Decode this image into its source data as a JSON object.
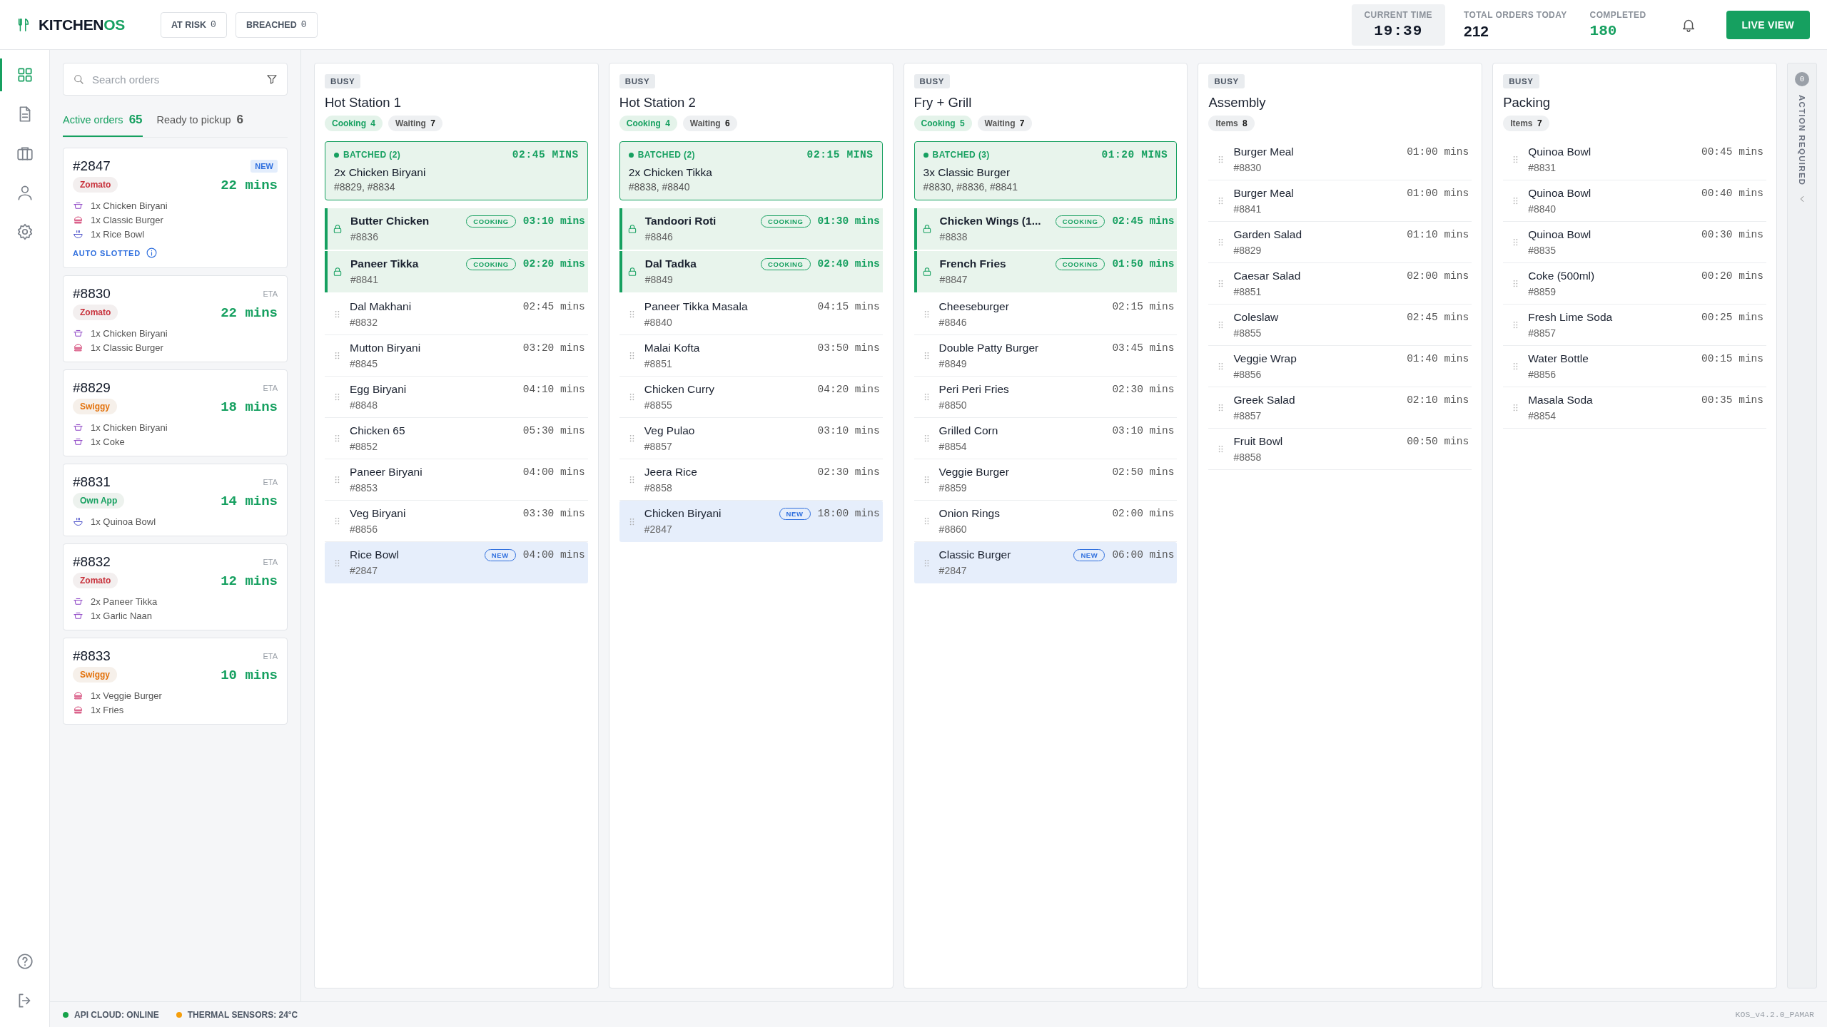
{
  "header": {
    "logo": {
      "primary": "KITCHEN",
      "accent": "OS"
    },
    "alerts": [
      {
        "label": "AT RISK",
        "count": "0"
      },
      {
        "label": "BREACHED",
        "count": "0"
      }
    ],
    "stats": [
      {
        "label": "CURRENT TIME",
        "value": "19:39",
        "kind": "boxed"
      },
      {
        "label": "TOTAL ORDERS TODAY",
        "value": "212",
        "kind": "plain"
      },
      {
        "label": "COMPLETED",
        "value": "180",
        "kind": "success"
      }
    ],
    "live_button": "LIVE VIEW"
  },
  "nav": {
    "items": [
      {
        "kind": "grid",
        "selected": true
      },
      {
        "kind": "document",
        "selected": false
      },
      {
        "kind": "briefcase",
        "selected": false
      },
      {
        "kind": "user",
        "selected": false
      },
      {
        "kind": "settings",
        "selected": false
      }
    ],
    "bottom": [
      {
        "kind": "help"
      },
      {
        "kind": "logout"
      }
    ]
  },
  "orders_panel": {
    "search": {
      "placeholder": "Search orders"
    },
    "tabs": [
      {
        "label": "Active orders",
        "count": "65",
        "selected": true
      },
      {
        "label": "Ready to pickup",
        "count": "6",
        "selected": false
      }
    ],
    "orders": [
      {
        "id": "#2847",
        "badge": {
          "text": "NEW",
          "kind": "new"
        },
        "source": {
          "name": "Zomato",
          "kind": "zomato"
        },
        "eta": "22 mins",
        "items": [
          {
            "text": "1x Chicken Biryani",
            "kind": "pot"
          },
          {
            "text": "1x Classic Burger",
            "kind": "burger"
          },
          {
            "text": "1x Rice Bowl",
            "kind": "bowl"
          }
        ],
        "auto_slot": "AUTO SLOTTED"
      },
      {
        "id": "#8830",
        "badge": {
          "text": "ETA",
          "kind": "eta"
        },
        "source": {
          "name": "Zomato",
          "kind": "zomato"
        },
        "eta": "22 mins",
        "items": [
          {
            "text": "1x Chicken Biryani",
            "kind": "pot"
          },
          {
            "text": "1x Classic Burger",
            "kind": "burger"
          }
        ]
      },
      {
        "id": "#8829",
        "badge": {
          "text": "ETA",
          "kind": "eta"
        },
        "source": {
          "name": "Swiggy",
          "kind": "swiggy"
        },
        "eta": "18 mins",
        "items": [
          {
            "text": "1x Chicken Biryani",
            "kind": "pot"
          },
          {
            "text": "1x Coke",
            "kind": "pot"
          }
        ]
      },
      {
        "id": "#8831",
        "badge": {
          "text": "ETA",
          "kind": "eta"
        },
        "source": {
          "name": "Own App",
          "kind": "own"
        },
        "eta": "14 mins",
        "items": [
          {
            "text": "1x Quinoa Bowl",
            "kind": "bowl"
          }
        ]
      },
      {
        "id": "#8832",
        "badge": {
          "text": "ETA",
          "kind": "eta"
        },
        "source": {
          "name": "Zomato",
          "kind": "zomato"
        },
        "eta": "12 mins",
        "items": [
          {
            "text": "2x Paneer Tikka",
            "kind": "pot"
          },
          {
            "text": "1x Garlic Naan",
            "kind": "pot"
          }
        ]
      },
      {
        "id": "#8833",
        "badge": {
          "text": "ETA",
          "kind": "eta"
        },
        "source": {
          "name": "Swiggy",
          "kind": "swiggy"
        },
        "eta": "10 mins",
        "items": [
          {
            "text": "1x Veggie Burger",
            "kind": "burger"
          },
          {
            "text": "1x Fries",
            "kind": "burger"
          }
        ]
      }
    ]
  },
  "stations": [
    {
      "status": "BUSY",
      "name": "Hot Station 1",
      "counts": [
        {
          "label": "Cooking",
          "value": "4",
          "kind": "cooking"
        },
        {
          "label": "Waiting",
          "value": "7",
          "kind": "waiting"
        }
      ],
      "batch": {
        "label": "BATCHED (2)",
        "time": "02:45 MINS",
        "title": "2x Chicken Biryani",
        "orders": "#8829, #8834"
      },
      "items": [
        {
          "name": "Butter Chicken",
          "order": "#8836",
          "time": "03:10 mins",
          "kind": "cooking",
          "tag": "COOKING"
        },
        {
          "name": "Paneer Tikka",
          "order": "#8841",
          "time": "02:20 mins",
          "kind": "cooking",
          "tag": "COOKING"
        },
        {
          "name": "Dal Makhani",
          "order": "#8832",
          "time": "02:45 mins",
          "kind": "queued"
        },
        {
          "name": "Mutton Biryani",
          "order": "#8845",
          "time": "03:20 mins",
          "kind": "queued"
        },
        {
          "name": "Egg Biryani",
          "order": "#8848",
          "time": "04:10 mins",
          "kind": "queued"
        },
        {
          "name": "Chicken 65",
          "order": "#8852",
          "time": "05:30 mins",
          "kind": "queued"
        },
        {
          "name": "Paneer Biryani",
          "order": "#8853",
          "time": "04:00 mins",
          "kind": "queued"
        },
        {
          "name": "Veg Biryani",
          "order": "#8856",
          "time": "03:30 mins",
          "kind": "queued"
        },
        {
          "name": "Rice Bowl",
          "order": "#2847",
          "time": "04:00 mins",
          "kind": "new",
          "tag": "NEW"
        }
      ]
    },
    {
      "status": "BUSY",
      "name": "Hot Station 2",
      "counts": [
        {
          "label": "Cooking",
          "value": "4",
          "kind": "cooking"
        },
        {
          "label": "Waiting",
          "value": "6",
          "kind": "waiting"
        }
      ],
      "batch": {
        "label": "BATCHED (2)",
        "time": "02:15 MINS",
        "title": "2x Chicken Tikka",
        "orders": "#8838, #8840"
      },
      "items": [
        {
          "name": "Tandoori Roti",
          "order": "#8846",
          "time": "01:30 mins",
          "kind": "cooking",
          "tag": "COOKING"
        },
        {
          "name": "Dal Tadka",
          "order": "#8849",
          "time": "02:40 mins",
          "kind": "cooking",
          "tag": "COOKING"
        },
        {
          "name": "Paneer Tikka Masala",
          "order": "#8840",
          "time": "04:15 mins",
          "kind": "queued"
        },
        {
          "name": "Malai Kofta",
          "order": "#8851",
          "time": "03:50 mins",
          "kind": "queued"
        },
        {
          "name": "Chicken Curry",
          "order": "#8855",
          "time": "04:20 mins",
          "kind": "queued"
        },
        {
          "name": "Veg Pulao",
          "order": "#8857",
          "time": "03:10 mins",
          "kind": "queued"
        },
        {
          "name": "Jeera Rice",
          "order": "#8858",
          "time": "02:30 mins",
          "kind": "queued"
        },
        {
          "name": "Chicken Biryani",
          "order": "#2847",
          "time": "18:00 mins",
          "kind": "new",
          "tag": "NEW"
        }
      ]
    },
    {
      "status": "BUSY",
      "name": "Fry + Grill",
      "counts": [
        {
          "label": "Cooking",
          "value": "5",
          "kind": "cooking"
        },
        {
          "label": "Waiting",
          "value": "7",
          "kind": "waiting"
        }
      ],
      "batch": {
        "label": "BATCHED (3)",
        "time": "01:20 MINS",
        "title": "3x Classic Burger",
        "orders": "#8830, #8836, #8841"
      },
      "items": [
        {
          "name": "Chicken Wings (1...",
          "order": "#8838",
          "time": "02:45 mins",
          "kind": "cooking",
          "tag": "COOKING"
        },
        {
          "name": "French Fries",
          "order": "#8847",
          "time": "01:50 mins",
          "kind": "cooking",
          "tag": "COOKING"
        },
        {
          "name": "Cheeseburger",
          "order": "#8846",
          "time": "02:15 mins",
          "kind": "queued"
        },
        {
          "name": "Double Patty Burger",
          "order": "#8849",
          "time": "03:45 mins",
          "kind": "queued"
        },
        {
          "name": "Peri Peri Fries",
          "order": "#8850",
          "time": "02:30 mins",
          "kind": "queued"
        },
        {
          "name": "Grilled Corn",
          "order": "#8854",
          "time": "03:10 mins",
          "kind": "queued"
        },
        {
          "name": "Veggie Burger",
          "order": "#8859",
          "time": "02:50 mins",
          "kind": "queued"
        },
        {
          "name": "Onion Rings",
          "order": "#8860",
          "time": "02:00 mins",
          "kind": "queued"
        },
        {
          "name": "Classic Burger",
          "order": "#2847",
          "time": "06:00 mins",
          "kind": "new",
          "tag": "NEW"
        }
      ]
    },
    {
      "status": "BUSY",
      "name": "Assembly",
      "counts": [
        {
          "label": "Items",
          "value": "8",
          "kind": "waiting"
        }
      ],
      "items": [
        {
          "name": "Burger Meal",
          "order": "#8830",
          "time": "01:00 mins",
          "kind": "queued"
        },
        {
          "name": "Burger Meal",
          "order": "#8841",
          "time": "01:00 mins",
          "kind": "queued"
        },
        {
          "name": "Garden Salad",
          "order": "#8829",
          "time": "01:10 mins",
          "kind": "queued"
        },
        {
          "name": "Caesar Salad",
          "order": "#8851",
          "time": "02:00 mins",
          "kind": "queued"
        },
        {
          "name": "Coleslaw",
          "order": "#8855",
          "time": "02:45 mins",
          "kind": "queued"
        },
        {
          "name": "Veggie Wrap",
          "order": "#8856",
          "time": "01:40 mins",
          "kind": "queued"
        },
        {
          "name": "Greek Salad",
          "order": "#8857",
          "time": "02:10 mins",
          "kind": "queued"
        },
        {
          "name": "Fruit Bowl",
          "order": "#8858",
          "time": "00:50 mins",
          "kind": "queued"
        }
      ]
    },
    {
      "status": "BUSY",
      "name": "Packing",
      "counts": [
        {
          "label": "Items",
          "value": "7",
          "kind": "waiting"
        }
      ],
      "items": [
        {
          "name": "Quinoa Bowl",
          "order": "#8831",
          "time": "00:45 mins",
          "kind": "queued"
        },
        {
          "name": "Quinoa Bowl",
          "order": "#8840",
          "time": "00:40 mins",
          "kind": "queued"
        },
        {
          "name": "Quinoa Bowl",
          "order": "#8835",
          "time": "00:30 mins",
          "kind": "queued"
        },
        {
          "name": "Coke (500ml)",
          "order": "#8859",
          "time": "00:20 mins",
          "kind": "queued"
        },
        {
          "name": "Fresh Lime Soda",
          "order": "#8857",
          "time": "00:25 mins",
          "kind": "queued"
        },
        {
          "name": "Water Bottle",
          "order": "#8856",
          "time": "00:15 mins",
          "kind": "queued"
        },
        {
          "name": "Masala Soda",
          "order": "#8854",
          "time": "00:35 mins",
          "kind": "queued"
        }
      ]
    }
  ],
  "action_rail": {
    "count": "0",
    "label": "ACTION REQUIRED"
  },
  "status_bar": {
    "statuses": [
      {
        "label": "API CLOUD: ONLINE",
        "color": "#16a34a"
      },
      {
        "label": "THERMAL SENSORS: 24°C",
        "color": "#f59e0b"
      }
    ],
    "version": "KOS_v4.2.0_PAMAR"
  }
}
